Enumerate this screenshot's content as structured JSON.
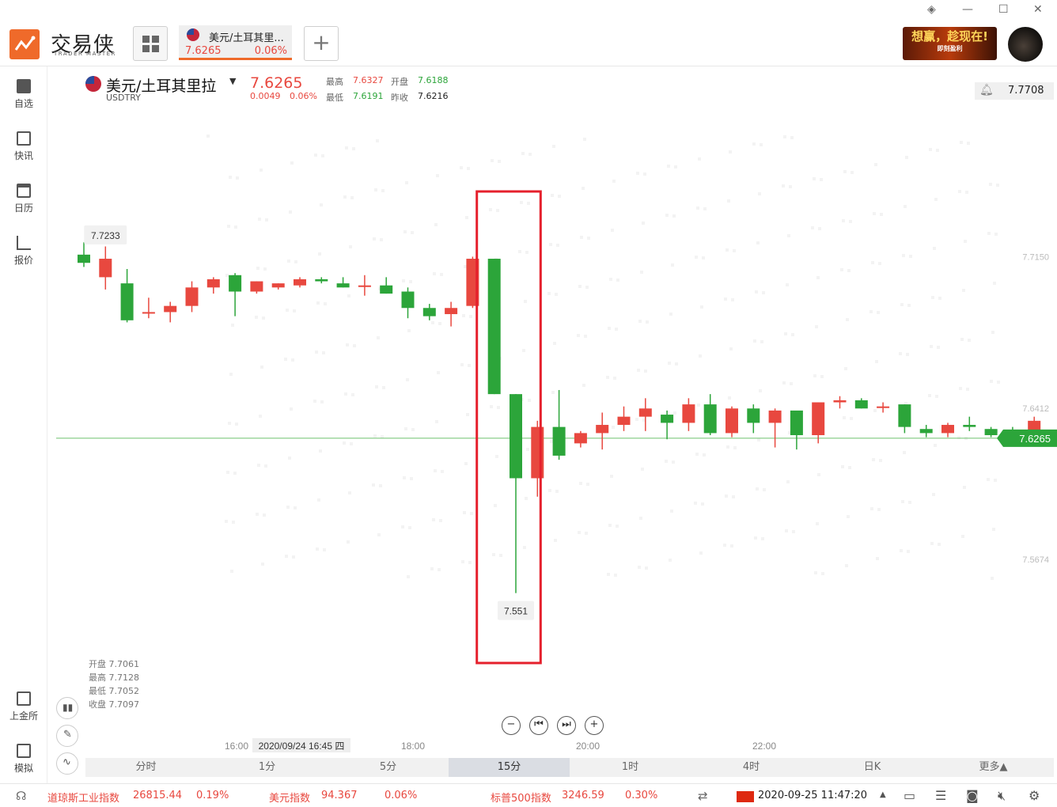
{
  "app": {
    "logo_text": "交易侠",
    "logo_sub": "TRADER MASTER"
  },
  "tab": {
    "name": "美元/土耳其里...",
    "price": "7.6265",
    "pct": "0.06%"
  },
  "ad": {
    "headline": "想赢，趁现在!",
    "sub": "即刻盈利"
  },
  "sidebar": {
    "items": [
      {
        "label": "自选",
        "icon": "bookmark-add-icon"
      },
      {
        "label": "快讯",
        "icon": "news-icon"
      },
      {
        "label": "日历",
        "icon": "calendar-icon"
      },
      {
        "label": "报价",
        "icon": "quote-chart-icon"
      },
      {
        "label": "上金所",
        "icon": "sge-icon"
      },
      {
        "label": "模拟",
        "icon": "simulate-icon"
      }
    ]
  },
  "symbol": {
    "name": "美元/土耳其里拉",
    "code": "USDTRY",
    "price": "7.6265",
    "change": "0.0049",
    "change_pct": "0.06%",
    "high_label": "最高",
    "high": "7.6327",
    "open_label": "开盘",
    "open": "7.6188",
    "low_label": "最低",
    "low": "7.6191",
    "prev_label": "昨收",
    "prev": "7.6216",
    "alert_price": "7.7708"
  },
  "ohlc_panel": {
    "open": "开盘 7.7061",
    "high": "最高 7.7128",
    "low": "最低 7.7052",
    "close": "收盘 7.7097"
  },
  "chart_data": {
    "type": "candlestick",
    "interval": "15分",
    "y_ticks": [
      "7.7150",
      "7.6412",
      "7.5674"
    ],
    "y_range": [
      7.52,
      7.79
    ],
    "last_price": 7.6265,
    "x_ticks": [
      "16:00",
      "18:00",
      "20:00",
      "22:00"
    ],
    "crosshair_time": "2020/09/24 16:45 四",
    "max_label": "7.7233",
    "min_label": "7.551",
    "candles": [
      {
        "o": 7.716,
        "h": 7.722,
        "l": 7.71,
        "c": 7.712
      },
      {
        "o": 7.705,
        "h": 7.72,
        "l": 7.699,
        "c": 7.714
      },
      {
        "o": 7.702,
        "h": 7.709,
        "l": 7.683,
        "c": 7.684
      },
      {
        "o": 7.688,
        "h": 7.695,
        "l": 7.685,
        "c": 7.688
      },
      {
        "o": 7.688,
        "h": 7.693,
        "l": 7.683,
        "c": 7.691
      },
      {
        "o": 7.691,
        "h": 7.703,
        "l": 7.688,
        "c": 7.7
      },
      {
        "o": 7.7,
        "h": 7.705,
        "l": 7.697,
        "c": 7.704
      },
      {
        "o": 7.706,
        "h": 7.707,
        "l": 7.686,
        "c": 7.698
      },
      {
        "o": 7.698,
        "h": 7.703,
        "l": 7.697,
        "c": 7.703
      },
      {
        "o": 7.7,
        "h": 7.702,
        "l": 7.699,
        "c": 7.702
      },
      {
        "o": 7.701,
        "h": 7.705,
        "l": 7.7,
        "c": 7.704
      },
      {
        "o": 7.704,
        "h": 7.705,
        "l": 7.702,
        "c": 7.703
      },
      {
        "o": 7.702,
        "h": 7.705,
        "l": 7.7,
        "c": 7.7
      },
      {
        "o": 7.701,
        "h": 7.706,
        "l": 7.696,
        "c": 7.701
      },
      {
        "o": 7.701,
        "h": 7.705,
        "l": 7.697,
        "c": 7.697
      },
      {
        "o": 7.698,
        "h": 7.7,
        "l": 7.685,
        "c": 7.69
      },
      {
        "o": 7.69,
        "h": 7.692,
        "l": 7.684,
        "c": 7.686
      },
      {
        "o": 7.687,
        "h": 7.693,
        "l": 7.681,
        "c": 7.69
      },
      {
        "o": 7.691,
        "h": 7.715,
        "l": 7.69,
        "c": 7.714
      },
      {
        "o": 7.714,
        "h": 7.714,
        "l": 7.648,
        "c": 7.648
      },
      {
        "o": 7.648,
        "h": 7.648,
        "l": 7.551,
        "c": 7.607
      },
      {
        "o": 7.607,
        "h": 7.635,
        "l": 7.598,
        "c": 7.632
      },
      {
        "o": 7.632,
        "h": 7.65,
        "l": 7.616,
        "c": 7.618
      },
      {
        "o": 7.624,
        "h": 7.63,
        "l": 7.622,
        "c": 7.629
      },
      {
        "o": 7.629,
        "h": 7.639,
        "l": 7.621,
        "c": 7.633
      },
      {
        "o": 7.633,
        "h": 7.642,
        "l": 7.63,
        "c": 7.637
      },
      {
        "o": 7.637,
        "h": 7.646,
        "l": 7.63,
        "c": 7.641
      },
      {
        "o": 7.638,
        "h": 7.64,
        "l": 7.626,
        "c": 7.634
      },
      {
        "o": 7.634,
        "h": 7.646,
        "l": 7.63,
        "c": 7.643
      },
      {
        "o": 7.643,
        "h": 7.648,
        "l": 7.628,
        "c": 7.629
      },
      {
        "o": 7.629,
        "h": 7.642,
        "l": 7.627,
        "c": 7.641
      },
      {
        "o": 7.641,
        "h": 7.643,
        "l": 7.629,
        "c": 7.634
      },
      {
        "o": 7.634,
        "h": 7.641,
        "l": 7.622,
        "c": 7.64
      },
      {
        "o": 7.64,
        "h": 7.639,
        "l": 7.621,
        "c": 7.628
      },
      {
        "o": 7.628,
        "h": 7.644,
        "l": 7.624,
        "c": 7.644
      },
      {
        "o": 7.644,
        "h": 7.647,
        "l": 7.641,
        "c": 7.645
      },
      {
        "o": 7.645,
        "h": 7.646,
        "l": 7.641,
        "c": 7.641
      },
      {
        "o": 7.642,
        "h": 7.644,
        "l": 7.639,
        "c": 7.642
      },
      {
        "o": 7.643,
        "h": 7.643,
        "l": 7.629,
        "c": 7.632
      },
      {
        "o": 7.631,
        "h": 7.633,
        "l": 7.627,
        "c": 7.629
      },
      {
        "o": 7.629,
        "h": 7.634,
        "l": 7.627,
        "c": 7.633
      },
      {
        "o": 7.633,
        "h": 7.637,
        "l": 7.63,
        "c": 7.632
      },
      {
        "o": 7.631,
        "h": 7.632,
        "l": 7.627,
        "c": 7.628
      },
      {
        "o": 7.628,
        "h": 7.632,
        "l": 7.624,
        "c": 7.627
      },
      {
        "o": 7.627,
        "h": 7.637,
        "l": 7.626,
        "c": 7.635
      }
    ],
    "highlight_range": [
      19,
      21
    ]
  },
  "timeframes": [
    "分时",
    "1分",
    "5分",
    "15分",
    "1时",
    "4时",
    "日K",
    "更多▲"
  ],
  "active_timeframe": "15分",
  "footer": {
    "ticker1_name": "道琼斯工业指数",
    "ticker1_value": "26815.44",
    "ticker1_pct": "0.19%",
    "ticker2_name": "美元指数",
    "ticker2_value": "94.367",
    "ticker2_pct": "0.06%",
    "ticker3_name": "标普500指数",
    "ticker3_value": "3246.59",
    "ticker3_pct": "0.30%",
    "datetime": "2020-09-25 11:47:20"
  },
  "colors": {
    "up": "#e8483f",
    "down": "#2ca53a",
    "accent": "#ef6a2a",
    "highlight_box": "#e5202c"
  }
}
